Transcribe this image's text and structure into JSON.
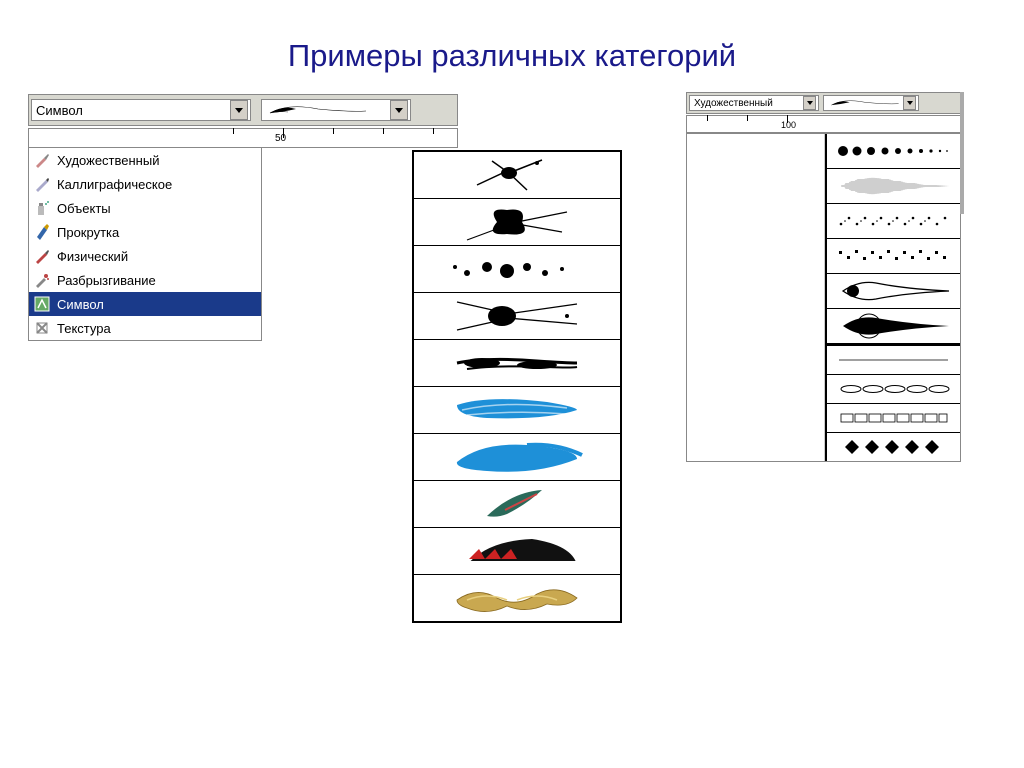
{
  "title": "Примеры различных категорий",
  "left": {
    "combo_value": "Символ",
    "ruler_label": "50",
    "items": [
      {
        "label": "Художественный",
        "icon": "brush"
      },
      {
        "label": "Каллиграфическое",
        "icon": "pen"
      },
      {
        "label": "Объекты",
        "icon": "spray-can"
      },
      {
        "label": "Прокрутка",
        "icon": "nib"
      },
      {
        "label": "Физический",
        "icon": "calligraphy"
      },
      {
        "label": "Разбрызгивание",
        "icon": "splat"
      },
      {
        "label": "Символ",
        "icon": "symbol",
        "selected": true
      },
      {
        "label": "Текстура",
        "icon": "texture"
      }
    ]
  },
  "right": {
    "combo_value": "Художественный",
    "ruler_label": "100"
  },
  "center_swatches": [
    "splat-twig",
    "big-splat",
    "dots-scatter",
    "splat-lines",
    "brush-smear",
    "blue-stroke-1",
    "blue-stroke-2",
    "feather",
    "ship-bow",
    "gold-flames"
  ],
  "right_swatches": [
    "dots-grad",
    "teardrop-tex",
    "wavy-dots",
    "square-dots-line",
    "teardrop-outline",
    "teardrop-clip"
  ],
  "right_lower": [
    "thin-line",
    "chain-ovals",
    "boxes-row",
    "diamonds-row"
  ]
}
